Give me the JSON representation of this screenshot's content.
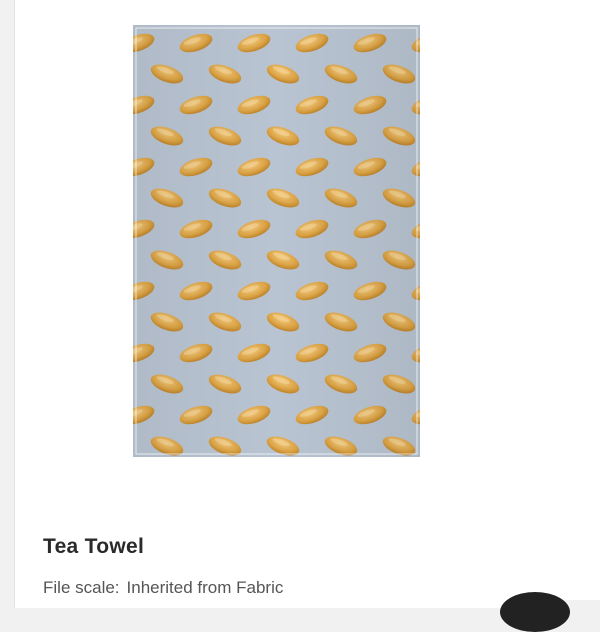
{
  "product": {
    "name": "Tea Towel",
    "file_scale_label": "File scale:",
    "file_scale_value": "Inherited from Fabric"
  },
  "colors": {
    "towel_background": "#b9c4d2",
    "bread_fill": "#d9a23f",
    "bread_highlight": "#edc277",
    "text_primary": "#2a2a2a",
    "text_secondary": "#555555"
  },
  "icons": {
    "scroll_button": "circle-button-icon"
  }
}
